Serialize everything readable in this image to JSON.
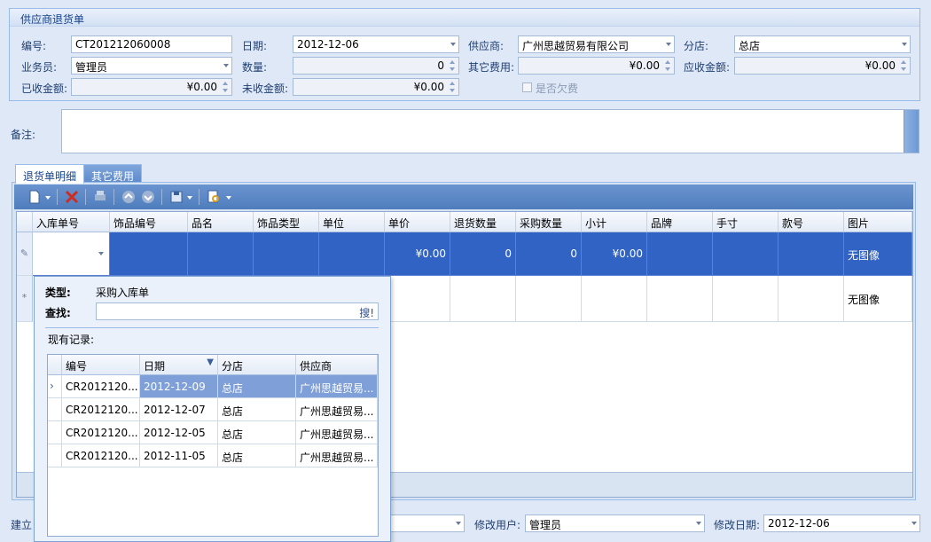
{
  "group": {
    "title": "供应商退货单"
  },
  "form": {
    "no_label": "编号:",
    "no_value": "CT201212060008",
    "date_label": "日期:",
    "date_value": "2012-12-06",
    "supplier_label": "供应商:",
    "supplier_value": "广州思越贸易有限公司",
    "branch_label": "分店:",
    "branch_value": "总店",
    "clerk_label": "业务员:",
    "clerk_value": "管理员",
    "qty_label": "数量:",
    "qty_value": "0",
    "other_fee_label": "其它费用:",
    "other_fee_value": "¥0.00",
    "receivable_label": "应收金额:",
    "receivable_value": "¥0.00",
    "received_label": "已收金额:",
    "received_value": "¥0.00",
    "unreceived_label": "未收金额:",
    "unreceived_value": "¥0.00",
    "owed_label": "是否欠费",
    "memo_label": "备注:"
  },
  "tabs": [
    {
      "label": "退货单明细"
    },
    {
      "label": "其它费用"
    }
  ],
  "grid": {
    "columns": [
      "入库单号",
      "饰品编号",
      "品名",
      "饰品类型",
      "单位",
      "单价",
      "退货数量",
      "采购数量",
      "小计",
      "品牌",
      "手寸",
      "款号",
      "图片"
    ],
    "row1": {
      "unit_price": "¥0.00",
      "return_qty": "0",
      "purchase_qty": "0",
      "subtotal": "¥0.00",
      "image": "无图像"
    },
    "row2": {
      "image": "无图像"
    }
  },
  "popup": {
    "type_label": "类型:",
    "type_value": "采购入库单",
    "search_label": "查找:",
    "search_button": "搜!",
    "records_label": "现有记录:",
    "columns": [
      "编号",
      "日期",
      "分店",
      "供应商"
    ],
    "rows": [
      [
        "CR2012120...",
        "2012-12-09",
        "总店",
        "广州思越贸易..."
      ],
      [
        "CR2012120...",
        "2012-12-07",
        "总店",
        "广州思越贸易..."
      ],
      [
        "CR2012120...",
        "2012-12-05",
        "总店",
        "广州思越贸易..."
      ],
      [
        "CR2012120...",
        "2012-11-05",
        "总店",
        "广州思越贸易..."
      ]
    ]
  },
  "footer": {
    "created_label": "建立",
    "modifier_label": "修改用户:",
    "modifier_value": "管理员",
    "modified_date_label": "修改日期:",
    "modified_date_value": "2012-12-06"
  },
  "icons": {
    "new": "new-document-icon",
    "delete": "delete-x-icon",
    "print": "print-icon",
    "up": "move-up-icon",
    "down": "move-down-icon",
    "save": "save-icon",
    "find": "find-icon"
  },
  "colors": {
    "selection": "#3163c5",
    "toolbar": "#5d89c9",
    "popup_selection": "#7e9fd8"
  }
}
